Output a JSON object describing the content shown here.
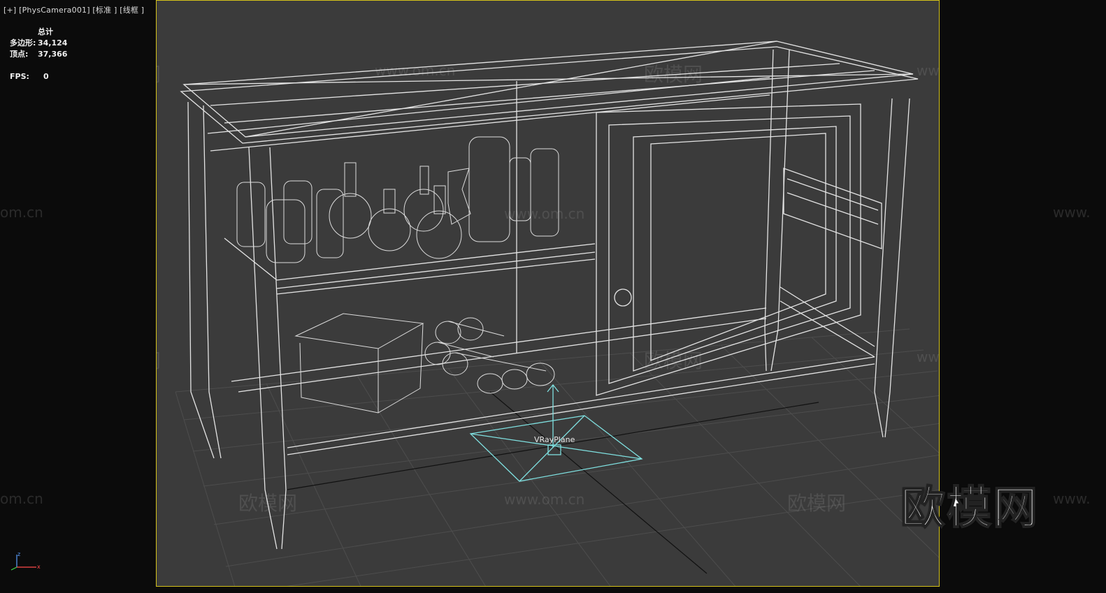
{
  "viewport": {
    "label_plus": "[+]",
    "label_camera": "[PhysCamera001]",
    "label_shading": "[标准 ]",
    "label_mode": "[线框 ]"
  },
  "stats": {
    "header": "总计",
    "polygons_label": "多边形:",
    "polygons_value": "34,124",
    "vertices_label": "顶点:",
    "vertices_value": "37,366",
    "fps_label": "FPS:",
    "fps_value": "0"
  },
  "scene": {
    "object_label": "VRayPlane"
  },
  "watermarks": {
    "brand": "欧模网",
    "url": "www.om.cn",
    "url_short": "om.cn",
    "url_prefix": "www."
  },
  "axis": {
    "x": "x",
    "z": "z"
  },
  "colors": {
    "border": "#d4c21a",
    "viewport_bg": "#3b3b3b",
    "helper": "#7fe0e0",
    "wire": "#e0e0e0"
  }
}
